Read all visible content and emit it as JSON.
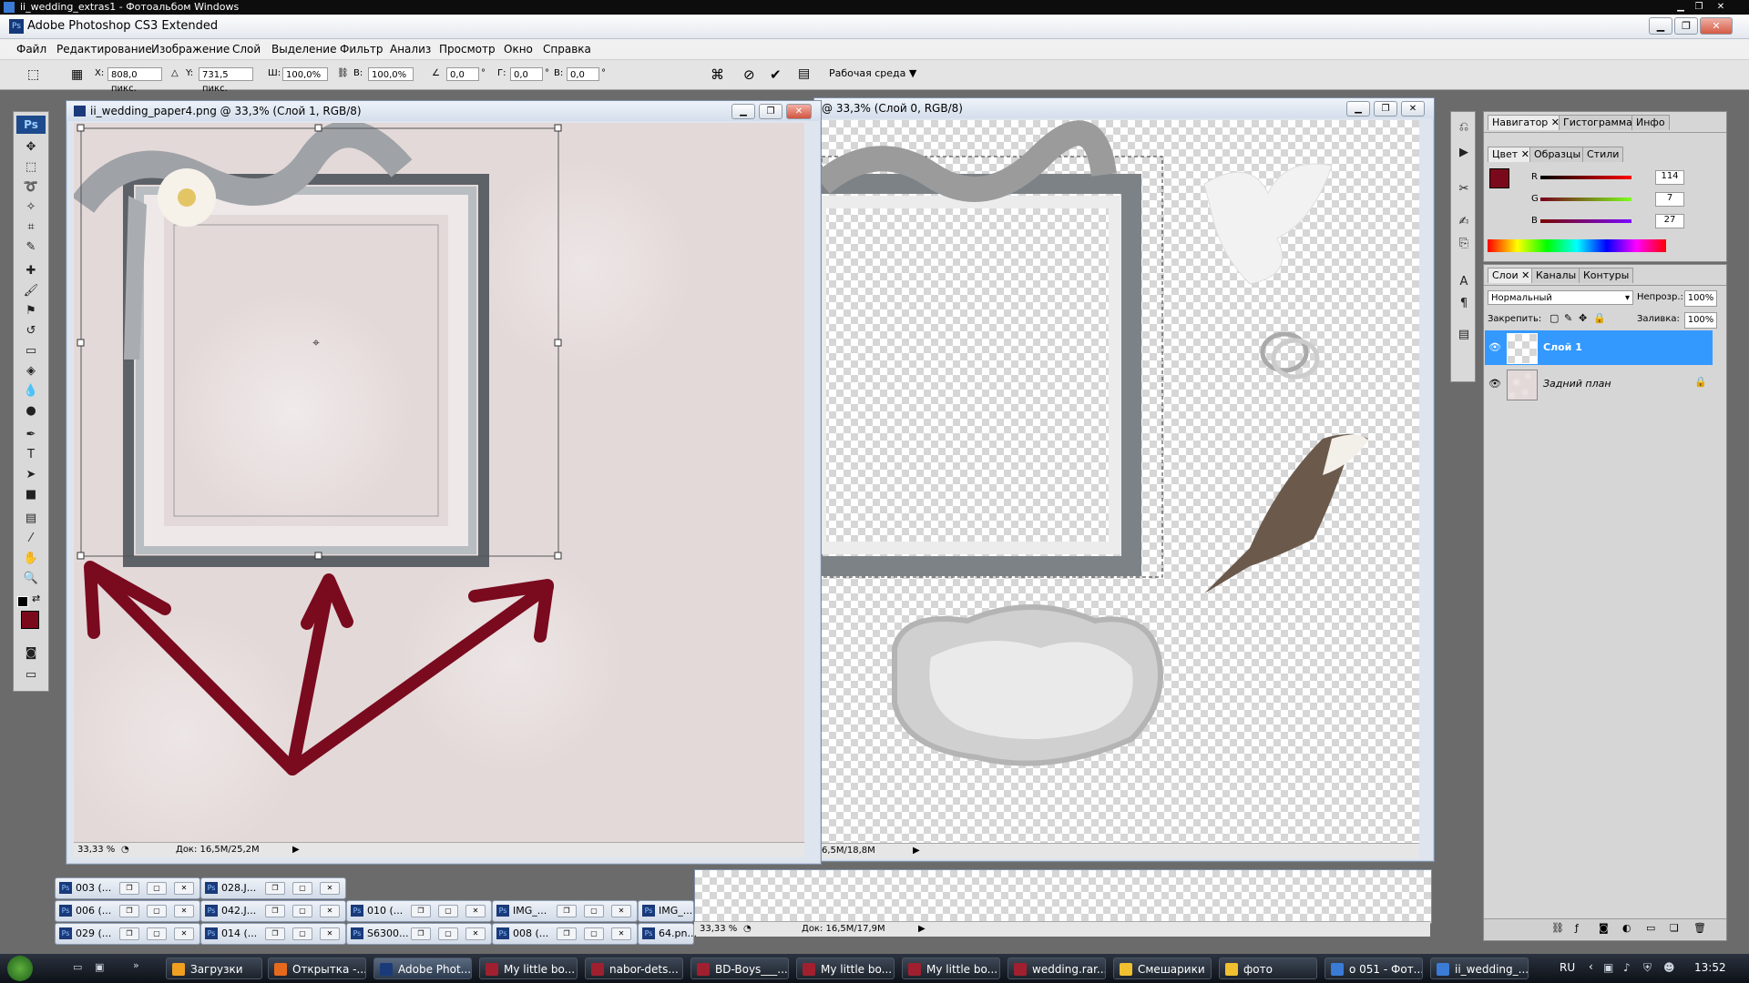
{
  "outer_window": {
    "title": "ii_wedding_extras1 - Фотоальбом Windows"
  },
  "app": {
    "title": "Adobe Photoshop CS3 Extended"
  },
  "menu": [
    "Файл",
    "Редактирование",
    "Изображение",
    "Слой",
    "Выделение",
    "Фильтр",
    "Анализ",
    "Просмотр",
    "Окно",
    "Справка"
  ],
  "options": {
    "x_label": "X:",
    "x_value": "808,0 пикс.",
    "y_label": "Y:",
    "y_value": "731,5 пикс.",
    "w_label": "Ш:",
    "w_value": "100,0%",
    "h_label": "В:",
    "h_value": "100,0%",
    "angle_value": "0,0",
    "hskew_label": "Г:",
    "hskew_value": "0,0",
    "vskew_label": "В:",
    "vskew_value": "0,0",
    "deg": "°",
    "workspace": "Рабочая среда"
  },
  "doc1": {
    "title": "ii_wedding_paper4.png @ 33,3% (Слой 1, RGB/8)",
    "zoom": "33,33 %",
    "doc_size": "Док: 16,5M/25,2M"
  },
  "doc2": {
    "title": "@ 33,3% (Слой 0, RGB/8)",
    "doc_size": "6,5M/18,8M"
  },
  "doc3": {
    "zoom": "33,33 %",
    "doc_size": "Док: 16,5M/17,9M"
  },
  "minimized": [
    {
      "label": "003 (..."
    },
    {
      "label": "028.J..."
    },
    {
      "label": "006 (..."
    },
    {
      "label": "042.J..."
    },
    {
      "label": "010 (..."
    },
    {
      "label": "IMG_..."
    },
    {
      "label": "IMG_..."
    },
    {
      "label": "029 (..."
    },
    {
      "label": "014 (..."
    },
    {
      "label": "S6300..."
    },
    {
      "label": "008 (..."
    },
    {
      "label": "64.pn..."
    }
  ],
  "panels": {
    "nav_tabs": [
      "Навигатор",
      "Гистограмма",
      "Инфо"
    ],
    "color_tabs": [
      "Цвет",
      "Образцы",
      "Стили"
    ],
    "r_label": "R",
    "r_value": "114",
    "g_label": "G",
    "g_value": "7",
    "b_label": "B",
    "b_value": "27",
    "layer_tabs": [
      "Слои",
      "Каналы",
      "Контуры"
    ],
    "blend_mode": "Нормальный",
    "opacity_label": "Непрозр.:",
    "opacity_value": "100%",
    "lock_label": "Закрепить:",
    "fill_label": "Заливка:",
    "fill_value": "100%",
    "layers": [
      {
        "name": "Слой 1"
      },
      {
        "name": "Задний план"
      }
    ]
  },
  "taskbar": {
    "items": [
      "Загрузки",
      "Открытка -...",
      "Adobe Phot...",
      "My little bo...",
      "nabor-dets...",
      "BD-Boys___...",
      "My little bo...",
      "My little bo...",
      "wedding.rar...",
      "Смешарики",
      "фото",
      "о 051 - Фот...",
      "ii_wedding_..."
    ],
    "lang": "RU",
    "time": "13:52"
  },
  "colors": {
    "foreground": "#7a0a1b",
    "accent": "#3399ff",
    "arrow": "#7a0a1e"
  }
}
